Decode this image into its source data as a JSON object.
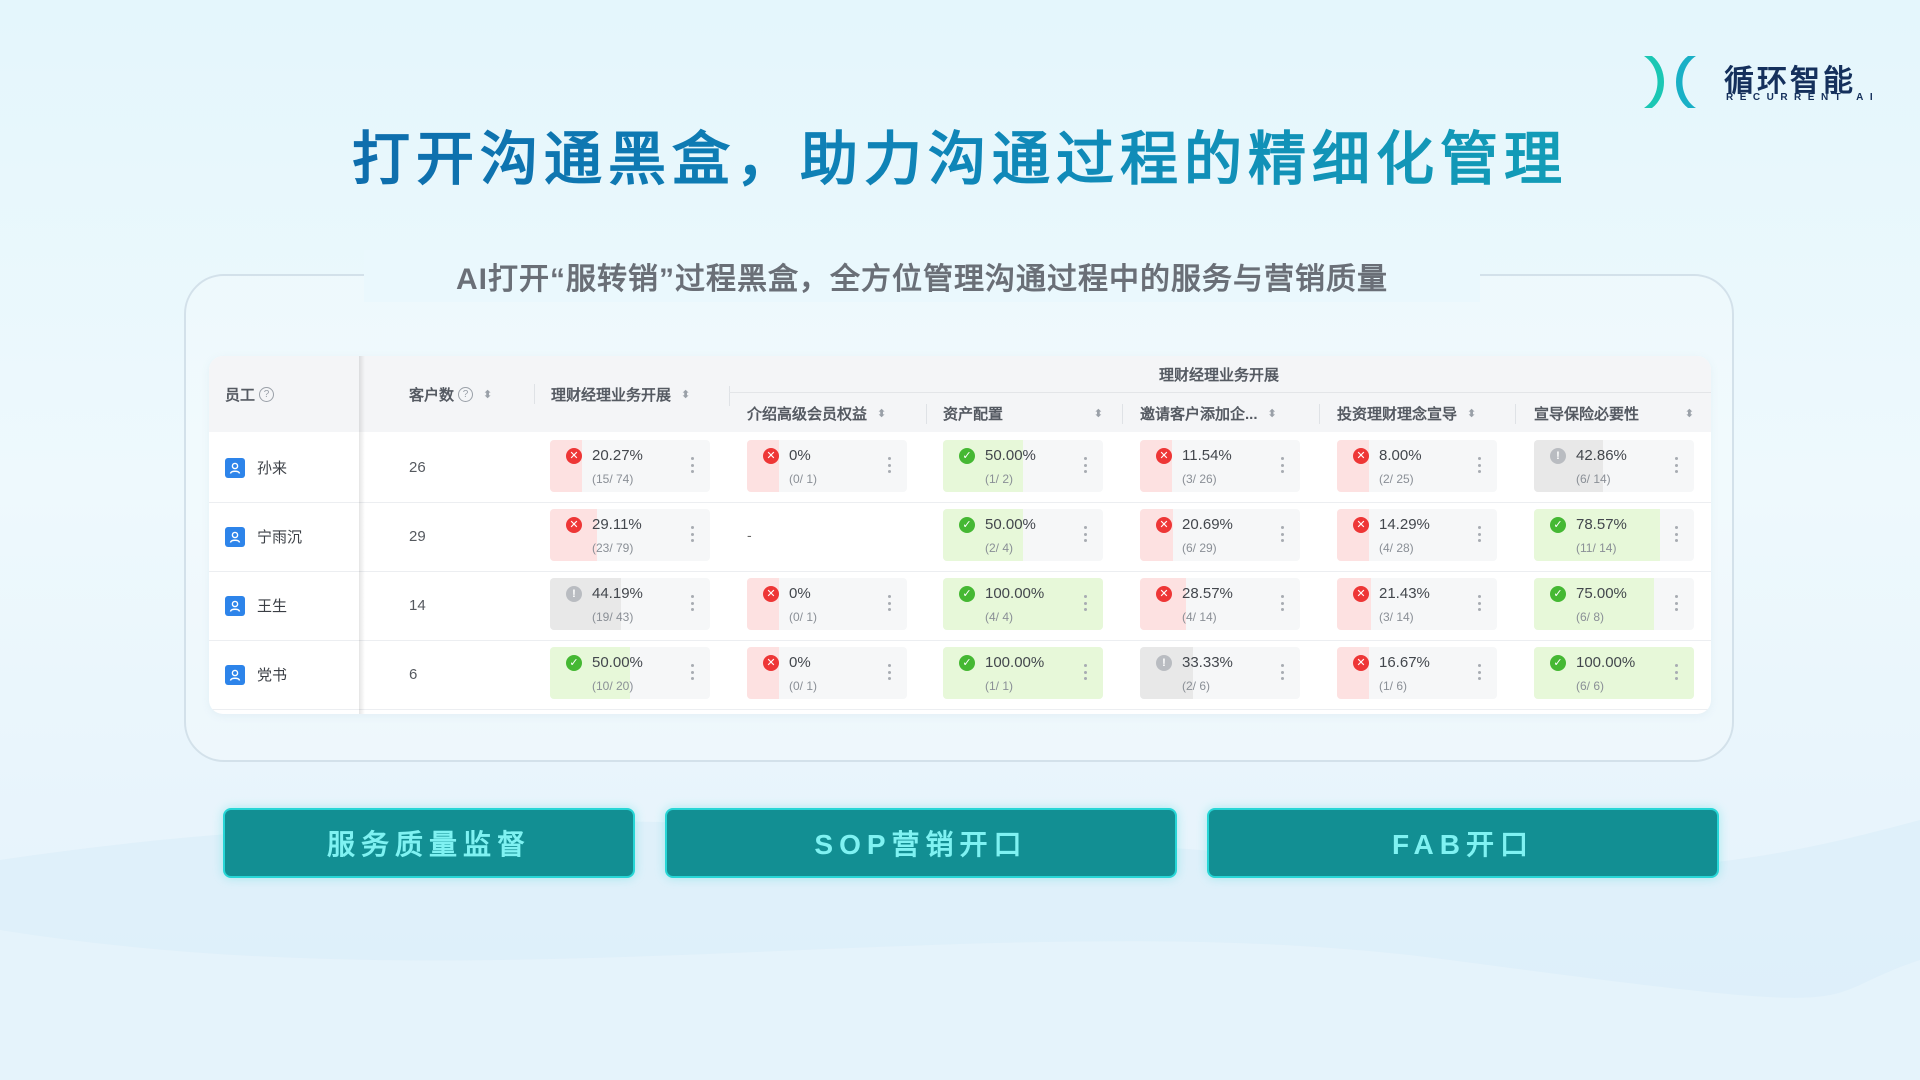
{
  "logo": {
    "name": "循环智能",
    "sub": "RECURRENT AI"
  },
  "title": "打开沟通黑盒，助力沟通过程的精细化管理",
  "subtitle": "AI打开“服转销”过程黑盒，全方位管理沟通过程中的服务与营销质量",
  "colors": {
    "accent": "#128f93",
    "button_border": "#27d6d6",
    "button_text": "#7ff2f2",
    "title": "#0d5fa6",
    "danger": "#ee3636",
    "success": "#45b833"
  },
  "table": {
    "headers": {
      "employee": "员工",
      "customers": "客户数",
      "business": "理财经理业务开展",
      "group": "理财经理业务开展",
      "sub": [
        "介绍高级会员权益",
        "资产配置",
        "邀请客户添加企...",
        "投资理财理念宣导",
        "宣导保险必要性"
      ]
    },
    "rows": [
      {
        "name": "孙来",
        "customers": "26",
        "cells": [
          {
            "status": "fail",
            "pct": "20.27%",
            "frac": "(15/ 74)",
            "level": 0.2027
          },
          {
            "status": "fail",
            "pct": "0%",
            "frac": "(0/ 1)",
            "level": 0
          },
          {
            "status": "pass",
            "pct": "50.00%",
            "frac": "(1/ 2)",
            "level": 0.5
          },
          {
            "status": "fail",
            "pct": "11.54%",
            "frac": "(3/ 26)",
            "level": 0.1154
          },
          {
            "status": "fail",
            "pct": "8.00%",
            "frac": "(2/ 25)",
            "level": 0.08
          },
          {
            "status": "neutral",
            "pct": "42.86%",
            "frac": "(6/ 14)",
            "level": 0.4286
          }
        ]
      },
      {
        "name": "宁雨沉",
        "customers": "29",
        "cells": [
          {
            "status": "fail",
            "pct": "29.11%",
            "frac": "(23/ 79)",
            "level": 0.2911
          },
          {
            "status": "empty",
            "pct": "-",
            "frac": "",
            "level": 0
          },
          {
            "status": "pass",
            "pct": "50.00%",
            "frac": "(2/ 4)",
            "level": 0.5
          },
          {
            "status": "fail",
            "pct": "20.69%",
            "frac": "(6/ 29)",
            "level": 0.2069
          },
          {
            "status": "fail",
            "pct": "14.29%",
            "frac": "(4/ 28)",
            "level": 0.1429
          },
          {
            "status": "pass",
            "pct": "78.57%",
            "frac": "(11/ 14)",
            "level": 0.7857
          }
        ]
      },
      {
        "name": "王生",
        "customers": "14",
        "cells": [
          {
            "status": "neutral",
            "pct": "44.19%",
            "frac": "(19/ 43)",
            "level": 0.4419
          },
          {
            "status": "fail",
            "pct": "0%",
            "frac": "(0/ 1)",
            "level": 0
          },
          {
            "status": "pass",
            "pct": "100.00%",
            "frac": "(4/ 4)",
            "level": 1
          },
          {
            "status": "fail",
            "pct": "28.57%",
            "frac": "(4/ 14)",
            "level": 0.2857
          },
          {
            "status": "fail",
            "pct": "21.43%",
            "frac": "(3/ 14)",
            "level": 0.2143
          },
          {
            "status": "pass",
            "pct": "75.00%",
            "frac": "(6/ 8)",
            "level": 0.75
          }
        ]
      },
      {
        "name": "党书",
        "customers": "6",
        "cells": [
          {
            "status": "pass",
            "pct": "50.00%",
            "frac": "(10/ 20)",
            "level": 0.5
          },
          {
            "status": "fail",
            "pct": "0%",
            "frac": "(0/ 1)",
            "level": 0
          },
          {
            "status": "pass",
            "pct": "100.00%",
            "frac": "(1/ 1)",
            "level": 1
          },
          {
            "status": "neutral",
            "pct": "33.33%",
            "frac": "(2/ 6)",
            "level": 0.3333
          },
          {
            "status": "fail",
            "pct": "16.67%",
            "frac": "(1/ 6)",
            "level": 0.1667
          },
          {
            "status": "pass",
            "pct": "100.00%",
            "frac": "(6/ 6)",
            "level": 1
          }
        ]
      }
    ]
  },
  "buttons": [
    "服务质量监督",
    "SOP营销开口",
    "FAB开口"
  ]
}
